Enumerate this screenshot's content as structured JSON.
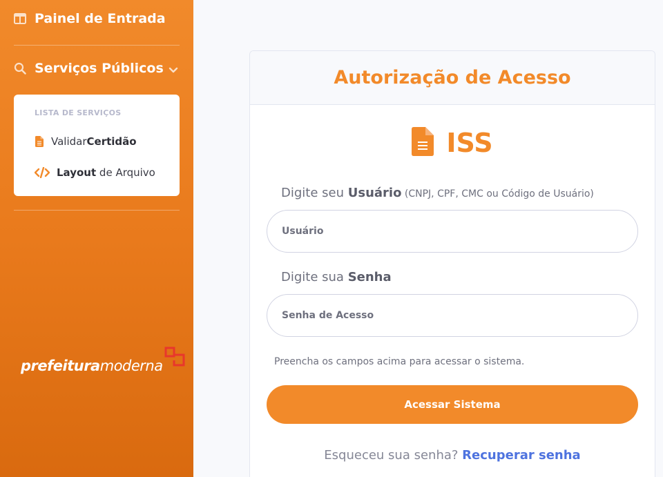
{
  "sidebar": {
    "painel_label": "Painel de Entrada",
    "servicos_label": "Serviços Públicos",
    "submenu": {
      "header": "LISTA DE SERVIÇOS",
      "items": [
        {
          "prefix": "Validar ",
          "bold": "Certidão",
          "suffix": "",
          "icon": "file-icon"
        },
        {
          "prefix": "",
          "bold": "Layout",
          "suffix": " de Arquivo",
          "icon": "code-icon"
        }
      ]
    },
    "logo": {
      "bold": "prefeitura",
      "regular": "moderna"
    }
  },
  "card": {
    "title": "Autorização de Acesso",
    "system_label": "ISS",
    "user_label": {
      "prefix": "Digite seu ",
      "bold": "Usuário",
      "note": " (CNPJ, CPF, CMC ou Código de Usuário)"
    },
    "user_placeholder": "Usuário",
    "pass_label": {
      "prefix": "Digite sua ",
      "bold": "Senha"
    },
    "pass_placeholder": "Senha de Acesso",
    "hint": "Preencha os campos acima para acessar o sistema.",
    "submit_label": "Acessar Sistema",
    "forgot_text": "Esqueceu sua senha? ",
    "recover_link": "Recuperar senha"
  },
  "colors": {
    "accent": "#f28a2a",
    "link": "#4e73df",
    "logo_mark": "#e8372c"
  }
}
